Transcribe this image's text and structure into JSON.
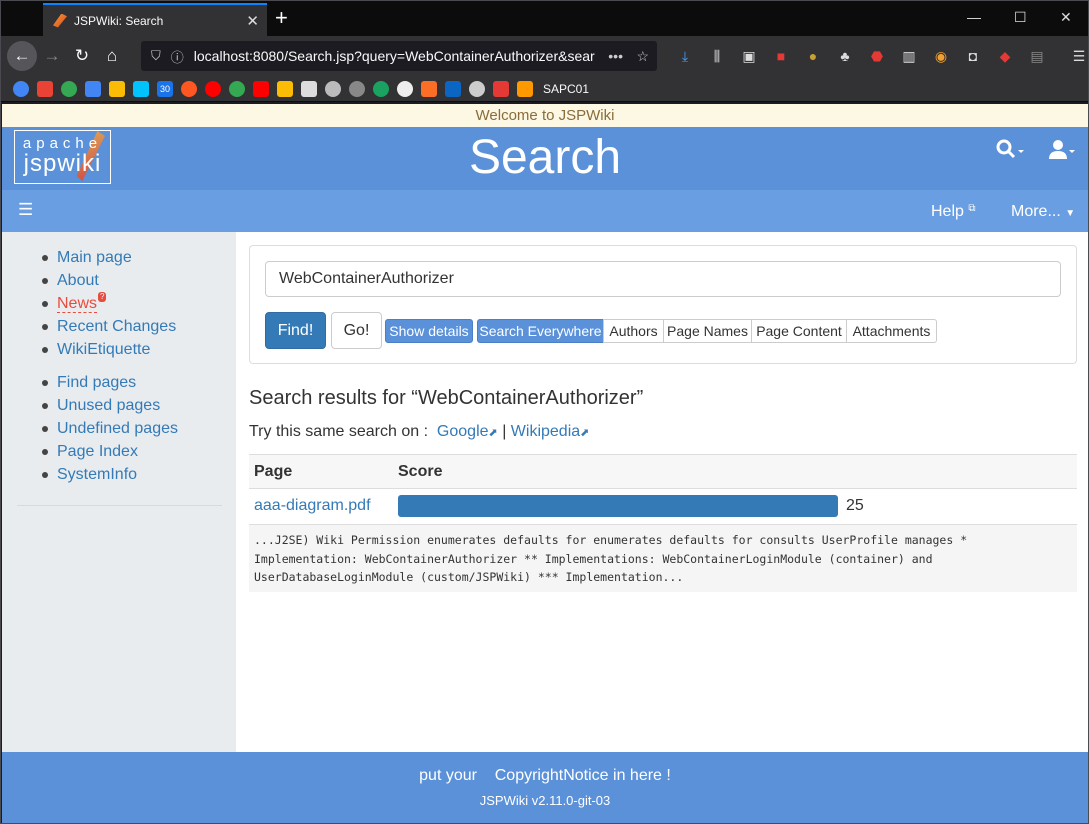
{
  "browser": {
    "tab_title": "JSPWiki: Search",
    "url": "localhost:8080/Search.jsp?query=WebContainerAuthorizer&sear",
    "bookmark_label": "SAPC01",
    "calendar_badge": "30"
  },
  "welcome": "Welcome to JSPWiki",
  "logo": {
    "line1": "apache",
    "line2": "jspwiki"
  },
  "page_title": "Search",
  "nav": {
    "help": "Help",
    "more": "More..."
  },
  "sidebar": {
    "group1": [
      "Main page",
      "About",
      "News",
      "Recent Changes",
      "WikiEtiquette"
    ],
    "news_badge": "?",
    "group2": [
      "Find pages",
      "Unused pages",
      "Undefined pages",
      "Page Index",
      "SystemInfo"
    ]
  },
  "search": {
    "query": "WebContainerAuthorizer",
    "find": "Find!",
    "go": "Go!",
    "show_details": "Show details",
    "scopes": [
      "Search Everywhere",
      "Authors",
      "Page Names",
      "Page Content",
      "Attachments"
    ]
  },
  "results": {
    "heading": "Search results for “WebContainerAuthorizer”",
    "try_label": "Try this same search on :",
    "google": "Google",
    "wikipedia": "Wikipedia",
    "separator": "|",
    "col_page": "Page",
    "col_score": "Score",
    "rows": [
      {
        "page": "aaa-diagram.pdf",
        "score": "25",
        "score_fraction": 1.0,
        "snippet": [
          "...J2SE) Wiki Permission enumerates defaults for enumerates defaults for consults UserProfile manages *",
          "Implementation: WebContainerAuthorizer ** Implementations: WebContainerLoginModule (container) and",
          "UserDatabaseLoginModule (custom/JSPWiki) *** Implementation..."
        ]
      }
    ]
  },
  "footer": {
    "line1a": "put your",
    "line1b": "CopyrightNotice in here !",
    "line2": "JSPWiki v2.11.0-git-03"
  },
  "colors": {
    "header": "#5a91d9",
    "nav": "#6a9ee2",
    "link": "#337ab7",
    "sidebar": "#e9ecef",
    "welcome_bg": "#fcf8e3"
  }
}
